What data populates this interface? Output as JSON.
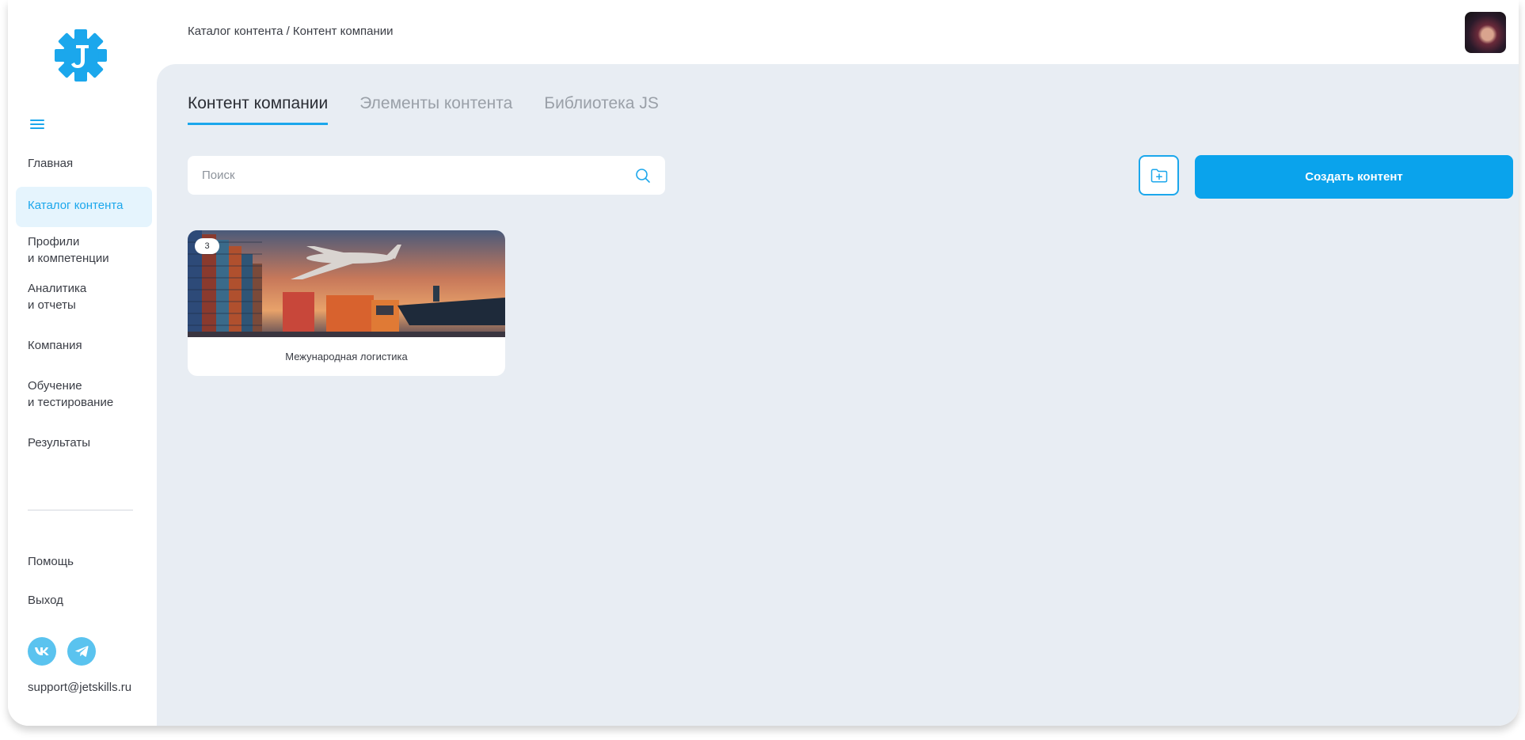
{
  "header": {
    "breadcrumb": "Каталог контента / Контент компании"
  },
  "sidebar": {
    "items": [
      {
        "label": "Главная"
      },
      {
        "label": "Каталог контента",
        "active": true
      },
      {
        "label_line1": "Профили",
        "label_line2": "и компетенции"
      },
      {
        "label_line1": "Аналитика",
        "label_line2": "и отчеты"
      },
      {
        "label": "Компания"
      },
      {
        "label_line1": "Обучение",
        "label_line2": "и тестирование"
      },
      {
        "label": "Результаты"
      }
    ],
    "help": "Помощь",
    "logout": "Выход",
    "support_email": "support@jetskills.ru"
  },
  "tabs": [
    "Контент компании",
    "Элементы контента",
    "Библиотека JS"
  ],
  "search": {
    "placeholder": "Поиск"
  },
  "actions": {
    "create_label": "Создать контент"
  },
  "cards": [
    {
      "badge": "3",
      "title": "Межународная логистика"
    }
  ],
  "colors": {
    "accent": "#1ba7ec",
    "button": "#0aa3ec",
    "main_bg": "#e8edf3"
  }
}
